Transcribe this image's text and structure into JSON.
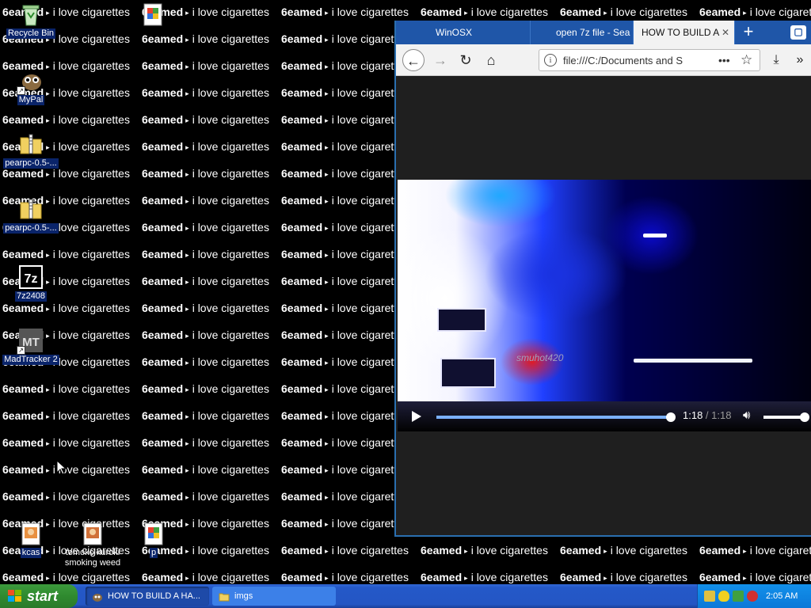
{
  "wallpaper": {
    "brand": "6eamed",
    "arrow": "▸",
    "phrase": "i love cigarettes"
  },
  "desktop_icons": [
    {
      "name": "recycle-bin-icon",
      "label": "Recycle Bin"
    },
    {
      "name": "mypal-icon",
      "label": "MyPal"
    },
    {
      "name": "pearpc-zip-icon-1",
      "label": "pearpc-0.5-..."
    },
    {
      "name": "pearpc-zip-icon-2",
      "label": "pearpc-0.5-..."
    },
    {
      "name": "7zip-icon",
      "label": "7z2408"
    },
    {
      "name": "madtracker-icon",
      "label": "MadTracker 2"
    },
    {
      "name": "kcas-icon",
      "label": "kcas"
    },
    {
      "name": "tomoko-icon",
      "label": "tomoko kuroki smoking weed"
    },
    {
      "name": "p-icon",
      "label": "p"
    }
  ],
  "browser": {
    "tabs": [
      {
        "label": "WinOSX"
      },
      {
        "label": "open 7z file - Sea"
      },
      {
        "label": "HOW TO BUILD A"
      }
    ],
    "new_tab": "+",
    "window_control": "▢",
    "nav": {
      "back": "←",
      "forward": "→",
      "reload": "↻",
      "home": "⌂"
    },
    "url": "file:///C:/Documents and S",
    "url_info": "i",
    "page_actions": "•••",
    "bookmark": "☆",
    "download": "⤓",
    "overflow": "»"
  },
  "video": {
    "watermark": "smuhot420",
    "current_time": "1:18",
    "separator": " / ",
    "duration": "1:18",
    "progress": 1.0,
    "volume": 1.0
  },
  "taskbar": {
    "start": "start",
    "tasks": [
      {
        "label": "HOW TO BUILD A HA..."
      },
      {
        "label": "imgs"
      }
    ],
    "clock": "2:05 AM"
  },
  "colors": {
    "taskbar_blue": "#2458c8",
    "start_green": "#2f8a2f",
    "browser_tab_blue": "#1f56a8",
    "icon_label_bg": "#0a246a"
  }
}
